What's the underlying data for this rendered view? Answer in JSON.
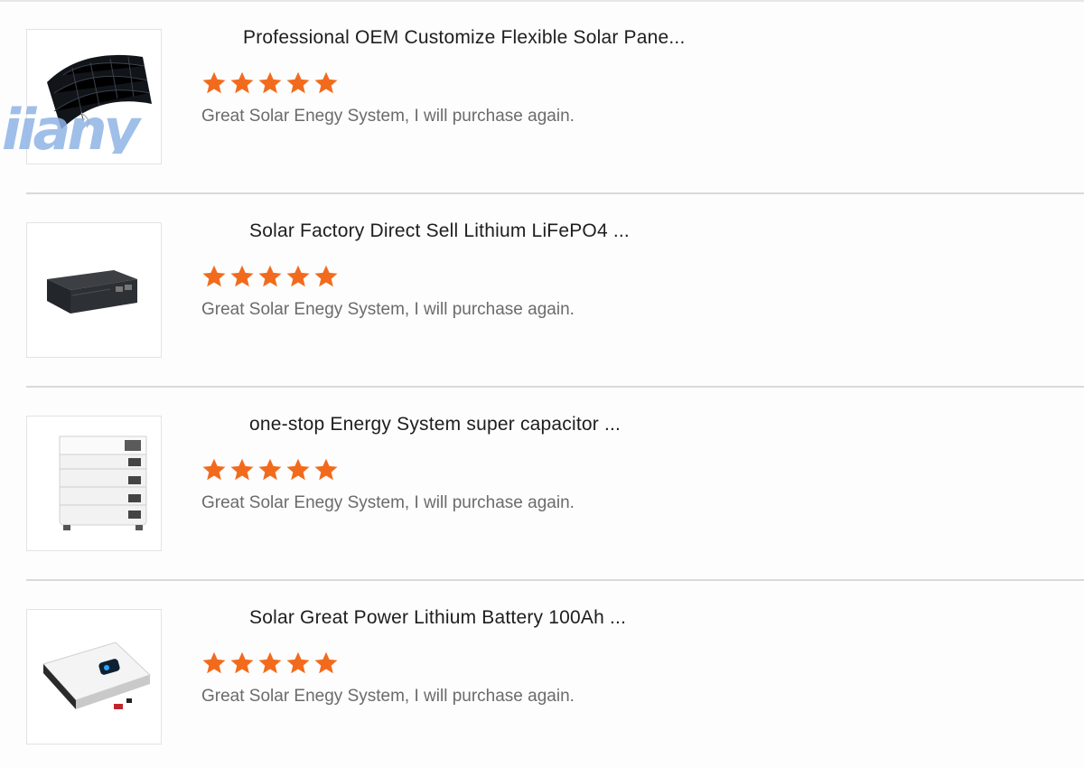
{
  "reviews": [
    {
      "title": "Professional OEM Customize Flexible Solar Pane...",
      "rating": 5,
      "comment": "Great Solar Enegy System, I will purchase again.",
      "image_icon": "flexible-solar-panel-icon"
    },
    {
      "title": "Solar Factory Direct Sell Lithium LiFePO4 ...",
      "rating": 5,
      "comment": "Great Solar Enegy System, I will purchase again.",
      "image_icon": "rack-battery-icon"
    },
    {
      "title": "one-stop Energy System super capacitor ...",
      "rating": 5,
      "comment": "Great Solar Enegy System, I will purchase again.",
      "image_icon": "stacked-battery-icon"
    },
    {
      "title": "Solar Great Power Lithium Battery 100Ah ...",
      "rating": 5,
      "comment": "Great Solar Enegy System, I will purchase again.",
      "image_icon": "wall-inverter-icon"
    }
  ],
  "watermark": "iiany",
  "colors": {
    "star": "#f26b1d",
    "title": "#1e1e1e",
    "comment": "#6b6b6b",
    "divider": "#d9d9d9",
    "watermark": "#8fb4e6"
  }
}
